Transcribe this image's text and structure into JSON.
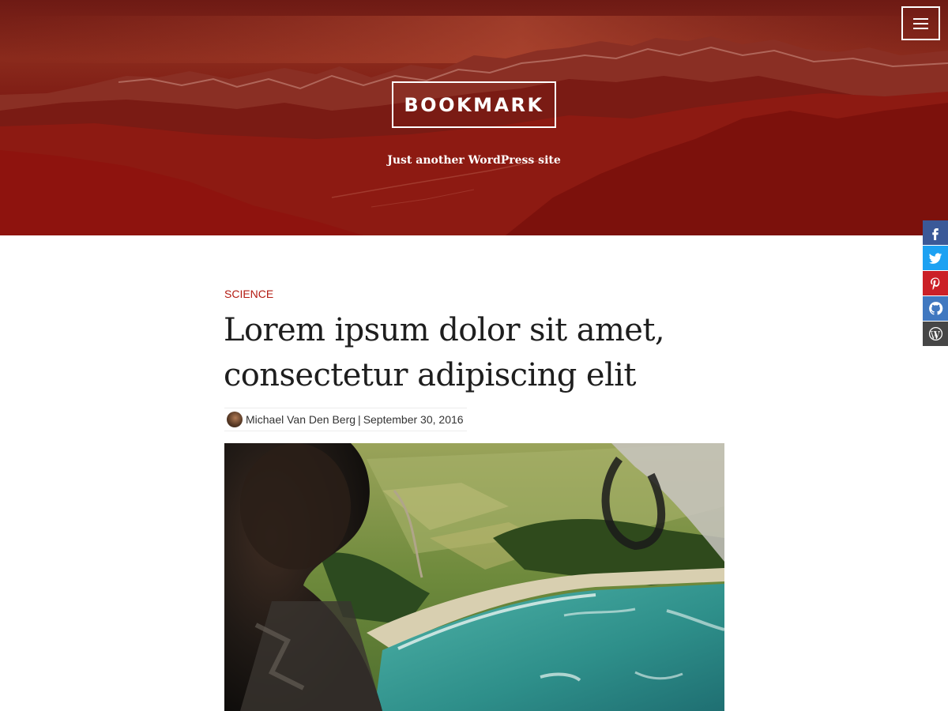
{
  "header": {
    "site_title": "BOOKMARK",
    "tagline": "Just another WordPress site",
    "menu_icon": "hamburger-menu-icon",
    "background_color": "#8e1611"
  },
  "social": {
    "items": [
      {
        "name": "facebook",
        "icon": "facebook-icon",
        "color": "#3b5998"
      },
      {
        "name": "twitter",
        "icon": "twitter-icon",
        "color": "#1da1f2"
      },
      {
        "name": "pinterest",
        "icon": "pinterest-icon",
        "color": "#cb2027"
      },
      {
        "name": "github",
        "icon": "github-icon",
        "color": "#4078c0"
      },
      {
        "name": "wordpress",
        "icon": "wordpress-icon",
        "color": "#464646"
      }
    ]
  },
  "post": {
    "category": "SCIENCE",
    "title": "Lorem ipsum dolor sit amet, consectetur adipiscing elit",
    "author": "Michael Van Den Berg",
    "separator": "|",
    "date": "September 30, 2016",
    "accent_color": "#b31b12"
  }
}
